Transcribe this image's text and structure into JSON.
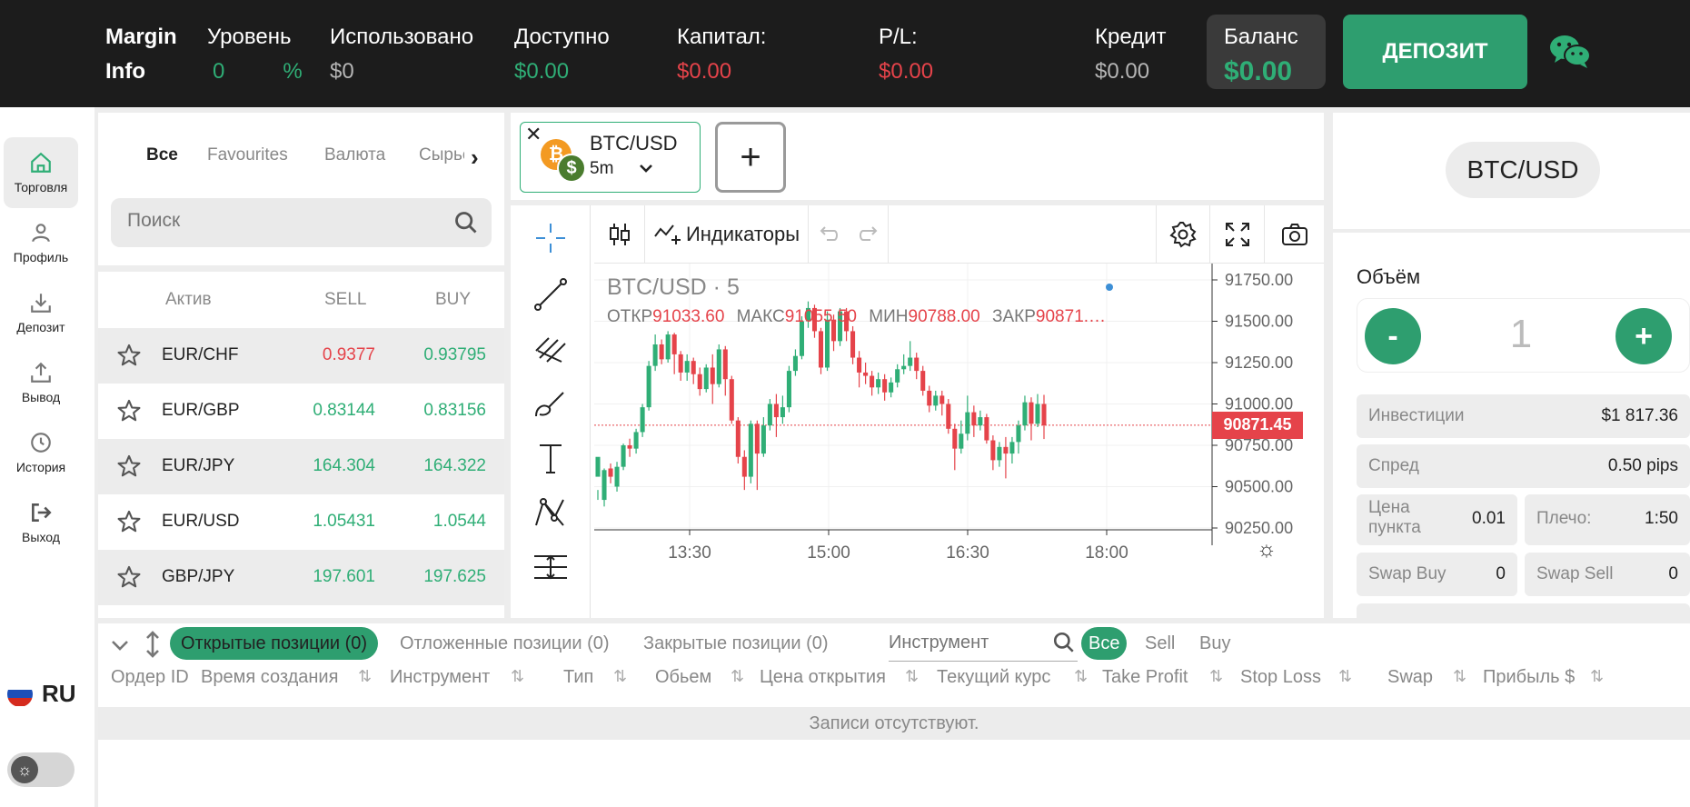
{
  "topbar": {
    "margin_info_line1": "Margin",
    "margin_info_line2": "Info",
    "level_label": "Уровень",
    "level_value": "0",
    "level_unit": "%",
    "used_label": "Использовано",
    "used_value": "$0",
    "available_label": "Доступно",
    "available_value": "$0.00",
    "capital_label": "Капитал:",
    "capital_value": "$0.00",
    "pl_label": "P/L:",
    "pl_value": "$0.00",
    "credit_label": "Кредит",
    "credit_value": "$0.00",
    "balance_label": "Баланс",
    "balance_value": "$0.00",
    "deposit_button": "ДЕПОЗИТ"
  },
  "sidebar": {
    "items": [
      {
        "label": "Торговля",
        "icon": "home-icon"
      },
      {
        "label": "Профиль",
        "icon": "user-icon"
      },
      {
        "label": "Депозит",
        "icon": "download-icon"
      },
      {
        "label": "Вывод",
        "icon": "upload-icon"
      },
      {
        "label": "История",
        "icon": "clock-icon"
      },
      {
        "label": "Выход",
        "icon": "logout-icon"
      }
    ],
    "language": "RU"
  },
  "instruments": {
    "tabs": [
      "Все",
      "Favourites",
      "Валюта",
      "Сырьё"
    ],
    "search_placeholder": "Поиск",
    "columns": {
      "asset": "Актив",
      "sell": "SELL",
      "buy": "BUY"
    },
    "rows": [
      {
        "symbol": "EUR/CHF",
        "sell": "0.9377",
        "buy": "0.93795",
        "sell_color": "#e5434a",
        "buy_color": "#2fae76"
      },
      {
        "symbol": "EUR/GBP",
        "sell": "0.83144",
        "buy": "0.83156",
        "sell_color": "#2fae76",
        "buy_color": "#2fae76"
      },
      {
        "symbol": "EUR/JPY",
        "sell": "164.304",
        "buy": "164.322",
        "sell_color": "#2fae76",
        "buy_color": "#2fae76"
      },
      {
        "symbol": "EUR/USD",
        "sell": "1.05431",
        "buy": "1.0544",
        "sell_color": "#2fae76",
        "buy_color": "#2fae76"
      },
      {
        "symbol": "GBP/JPY",
        "sell": "197.601",
        "buy": "197.625",
        "sell_color": "#2fae76",
        "buy_color": "#2fae76"
      }
    ]
  },
  "chart_tab": {
    "symbol": "BTC/USD",
    "timeframe": "5m",
    "close_glyph": "✕",
    "add_glyph": "+"
  },
  "chart_toolbar": {
    "indicators_label": "Индикаторы"
  },
  "chart_data": {
    "type": "candlestick",
    "title": "BTC/USD · 5",
    "ohlc_labels": {
      "open": "ОТКР",
      "high": "МАКС",
      "low": "МИН",
      "close": "ЗАКР"
    },
    "ohlc_values": {
      "open": "91033.60",
      "high": "91055.50",
      "low": "90788.00",
      "close": "90871.…"
    },
    "y_ticks": [
      "91750.00",
      "91500.00",
      "91250.00",
      "91000.00",
      "90750.00",
      "90500.00",
      "90250.00"
    ],
    "y_tick_values": [
      91750,
      91500,
      91250,
      91000,
      90750,
      90500,
      90250
    ],
    "x_ticks": [
      "13:30",
      "15:00",
      "16:30",
      "18:00"
    ],
    "last_price": "90871.45",
    "last_price_value": 90871.45,
    "up_color": "#2fae76",
    "down_color": "#e5434a",
    "candles": [
      [
        90560,
        90680,
        90480,
        90420
      ],
      [
        90420,
        90600,
        90610,
        90380
      ],
      [
        90610,
        90560,
        90640,
        90520
      ],
      [
        90500,
        90620,
        90650,
        90470
      ],
      [
        90620,
        90750,
        90760,
        90600
      ],
      [
        90750,
        90730,
        90790,
        90680
      ],
      [
        90730,
        90830,
        90850,
        90700
      ],
      [
        90830,
        90980,
        91000,
        90800
      ],
      [
        90980,
        91230,
        91260,
        90960
      ],
      [
        91230,
        91360,
        91420,
        91200
      ],
      [
        91360,
        91270,
        91390,
        91240
      ],
      [
        91270,
        91420,
        91440,
        91250
      ],
      [
        91420,
        91300,
        91430,
        91180
      ],
      [
        91300,
        91190,
        91320,
        91140
      ],
      [
        91190,
        91260,
        91300,
        91140
      ],
      [
        91260,
        91180,
        91280,
        91120
      ],
      [
        91180,
        91090,
        91220,
        91050
      ],
      [
        91090,
        91220,
        91240,
        91070
      ],
      [
        91220,
        91120,
        91300,
        91000
      ],
      [
        91120,
        91330,
        91360,
        91100
      ],
      [
        91330,
        91150,
        91350,
        91050
      ],
      [
        91150,
        90900,
        91170,
        90880
      ],
      [
        90900,
        90680,
        90920,
        90640
      ],
      [
        90680,
        90560,
        90720,
        90480
      ],
      [
        90560,
        90880,
        90900,
        90520
      ],
      [
        90880,
        90700,
        90900,
        90480
      ],
      [
        90700,
        90870,
        90920,
        90680
      ],
      [
        90870,
        91000,
        91030,
        90840
      ],
      [
        91000,
        90920,
        91060,
        90800
      ],
      [
        90920,
        90980,
        91050,
        90880
      ],
      [
        90980,
        91200,
        91230,
        90950
      ],
      [
        91200,
        91290,
        91330,
        91170
      ],
      [
        91290,
        91500,
        91530,
        91270
      ],
      [
        91500,
        91580,
        91620,
        91460
      ],
      [
        91580,
        91440,
        91600,
        91400
      ],
      [
        91440,
        91220,
        91460,
        91180
      ],
      [
        91220,
        91510,
        91560,
        91200
      ],
      [
        91510,
        91380,
        91540,
        91320
      ],
      [
        91380,
        91560,
        91580,
        91350
      ],
      [
        91560,
        91440,
        91580,
        91380
      ],
      [
        91440,
        91280,
        91470,
        91240
      ],
      [
        91280,
        91190,
        91320,
        91100
      ],
      [
        91190,
        91170,
        91250,
        91120
      ],
      [
        91170,
        91100,
        91200,
        91050
      ],
      [
        91100,
        91150,
        91190,
        91060
      ],
      [
        91150,
        91070,
        91180,
        91020
      ],
      [
        91070,
        91130,
        91160,
        91040
      ],
      [
        91130,
        91210,
        91240,
        91100
      ],
      [
        91210,
        91230,
        91300,
        91180
      ],
      [
        91230,
        91280,
        91380,
        91200
      ],
      [
        91280,
        91200,
        91310,
        91150
      ],
      [
        91200,
        91080,
        91230,
        91050
      ],
      [
        91080,
        90990,
        91110,
        90950
      ],
      [
        90990,
        91050,
        91080,
        90960
      ],
      [
        91050,
        91000,
        91080,
        90930
      ],
      [
        91000,
        90850,
        91030,
        90820
      ],
      [
        90850,
        90730,
        90880,
        90600
      ],
      [
        90730,
        90820,
        90900,
        90700
      ],
      [
        90820,
        90950,
        91050,
        90780
      ],
      [
        90950,
        90870,
        90990,
        90800
      ],
      [
        90870,
        90920,
        90960,
        90840
      ],
      [
        90920,
        90780,
        90940,
        90760
      ],
      [
        90780,
        90660,
        90810,
        90600
      ],
      [
        90660,
        90740,
        90770,
        90620
      ],
      [
        90740,
        90700,
        90800,
        90550
      ],
      [
        90700,
        90770,
        90800,
        90640
      ],
      [
        90770,
        90870,
        90900,
        90700
      ],
      [
        90870,
        91010,
        91050,
        90840
      ],
      [
        91010,
        90880,
        91040,
        90780
      ],
      [
        90880,
        91000,
        91060,
        90860
      ],
      [
        91000,
        90871,
        91055,
        90788
      ]
    ]
  },
  "order_panel": {
    "symbol": "BTC/USD",
    "volume_label": "Объём",
    "volume_value": "1",
    "minus": "-",
    "plus": "+",
    "investments_label": "Инвестиции",
    "investments_value": "$1 817.36",
    "spread_label": "Спред",
    "spread_value": "0.50 pips",
    "pip_price_label_1": "Цена",
    "pip_price_label_2": "пункта",
    "pip_price_value": "0.01",
    "leverage_label": "Плечо:",
    "leverage_value": "1:50",
    "swap_buy_label": "Swap Buy",
    "swap_buy_value": "0",
    "swap_sell_label": "Swap Sell",
    "swap_sell_value": "0"
  },
  "positions": {
    "tabs": {
      "open": "Открытые позиции (0)",
      "pending": "Отложенные позиции (0)",
      "closed": "Закрытые позиции (0)"
    },
    "instrument_placeholder": "Инструмент",
    "filters": {
      "all": "Все",
      "sell": "Sell",
      "buy": "Buy"
    },
    "columns": [
      "Ордер ID",
      "Время создания",
      "Инструмент",
      "Тип",
      "Обьем",
      "Цена открытия",
      "Текущий курс",
      "Take Profit",
      "Stop Loss",
      "Swap",
      "Прибыль $"
    ],
    "empty_text": "Записи отсутствуют."
  }
}
